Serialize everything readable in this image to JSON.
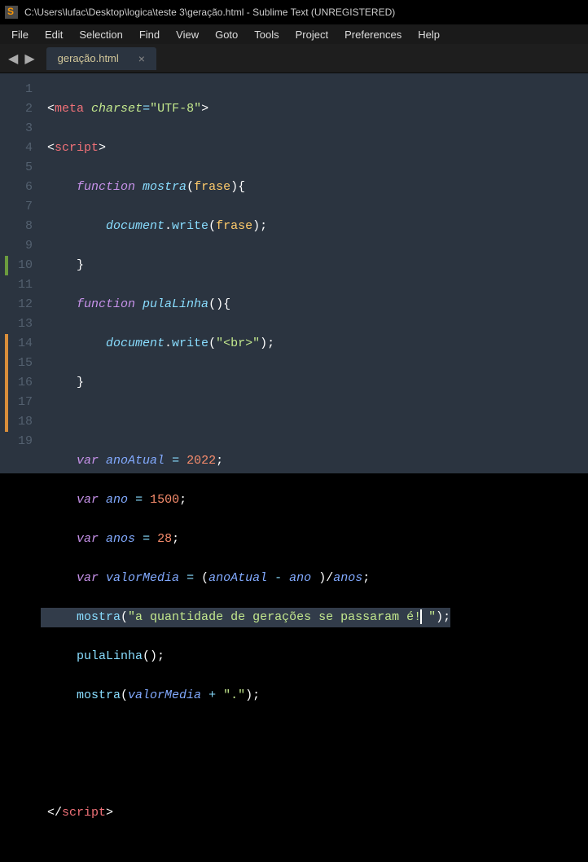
{
  "title": "C:\\Users\\lufac\\Desktop\\logica\\teste 3\\geração.html - Sublime Text (UNREGISTERED)",
  "menu": [
    "File",
    "Edit",
    "Selection",
    "Find",
    "View",
    "Goto",
    "Tools",
    "Project",
    "Preferences",
    "Help"
  ],
  "tab": {
    "name": "geração.html",
    "close": "×"
  },
  "nav": {
    "left": "◀",
    "right": "▶"
  },
  "lines": [
    1,
    2,
    3,
    4,
    5,
    6,
    7,
    8,
    9,
    10,
    11,
    12,
    13,
    14,
    15,
    16,
    17,
    18,
    19
  ],
  "modbars": {
    "9": "green",
    "13": "orange",
    "14": "orange",
    "15": "orange",
    "16": "orange",
    "17": "orange"
  },
  "highlight_line": 14,
  "code": {
    "l1": {
      "p0": "<",
      "p1": "meta",
      "p2": " ",
      "p3": "charset",
      "p4": "=",
      "p5": "\"UTF-8\"",
      "p6": ">"
    },
    "l2": {
      "p0": "<",
      "p1": "script",
      "p2": ">"
    },
    "l3": {
      "p0": "    ",
      "p1": "function",
      "p2": " ",
      "p3": "mostra",
      "p4": "(",
      "p5": "frase",
      "p6": "){"
    },
    "l4": {
      "p0": "        ",
      "p1": "document",
      "p2": ".",
      "p3": "write",
      "p4": "(",
      "p5": "frase",
      "p6": ");"
    },
    "l5": {
      "p0": "    }"
    },
    "l6": {
      "p0": "    ",
      "p1": "function",
      "p2": " ",
      "p3": "pulaLinha",
      "p4": "(){"
    },
    "l7": {
      "p0": "        ",
      "p1": "document",
      "p2": ".",
      "p3": "write",
      "p4": "(",
      "p5": "\"<br>\"",
      "p6": ");"
    },
    "l8": {
      "p0": "    }"
    },
    "l9": {
      "p0": ""
    },
    "l10": {
      "p0": "    ",
      "p1": "var",
      "p2": " ",
      "p3": "anoAtual",
      "p4": " ",
      "p5": "=",
      "p6": " ",
      "p7": "2022",
      "p8": ";"
    },
    "l11": {
      "p0": "    ",
      "p1": "var",
      "p2": " ",
      "p3": "ano",
      "p4": " ",
      "p5": "=",
      "p6": " ",
      "p7": "1500",
      "p8": ";"
    },
    "l12": {
      "p0": "    ",
      "p1": "var",
      "p2": " ",
      "p3": "anos",
      "p4": " ",
      "p5": "=",
      "p6": " ",
      "p7": "28",
      "p8": ";"
    },
    "l13": {
      "p0": "    ",
      "p1": "var",
      "p2": " ",
      "p3": "valorMedia",
      "p4": " ",
      "p5": "=",
      "p6": " (",
      "p7": "anoAtual",
      "p8": " ",
      "p9": "-",
      "p10": " ",
      "p11": "ano",
      "p12": " )/",
      "p13": "anos",
      "p14": ";"
    },
    "l14": {
      "p0": "    ",
      "p1": "mostra",
      "p2": "(",
      "p3": "\"a quantidade de gerações se passaram é!",
      "p4": " \"",
      "p5": ");"
    },
    "l15": {
      "p0": "    ",
      "p1": "pulaLinha",
      "p2": "();"
    },
    "l16": {
      "p0": "    ",
      "p1": "mostra",
      "p2": "(",
      "p3": "valorMedia",
      "p4": " ",
      "p5": "+",
      "p6": " ",
      "p7": "\".\"",
      "p8": ");"
    },
    "l17": {
      "p0": ""
    },
    "l18": {
      "p0": ""
    },
    "l19": {
      "p0": "</",
      "p1": "script",
      "p2": ">"
    }
  }
}
